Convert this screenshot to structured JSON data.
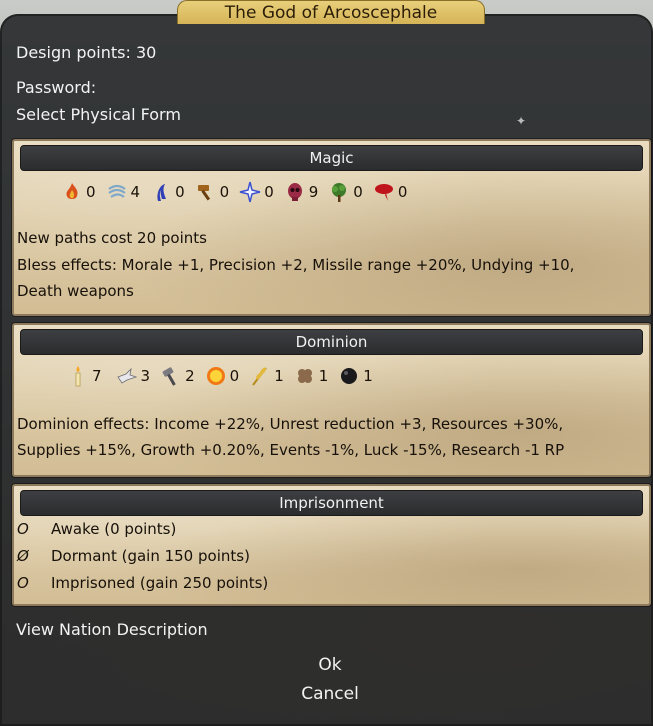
{
  "window": {
    "title": "The God of Arcoscephale"
  },
  "header": {
    "design_points": "Design points: 30",
    "password_label": "Password:",
    "physical_form_link": "Select Physical Form"
  },
  "magic": {
    "title": "Magic",
    "paths": [
      {
        "icon": "fire-icon",
        "value": "0"
      },
      {
        "icon": "air-icon",
        "value": "4"
      },
      {
        "icon": "water-icon",
        "value": "0"
      },
      {
        "icon": "earth-icon",
        "value": "0"
      },
      {
        "icon": "astral-icon",
        "value": "0"
      },
      {
        "icon": "death-icon",
        "value": "9"
      },
      {
        "icon": "nature-icon",
        "value": "0"
      },
      {
        "icon": "blood-icon",
        "value": "0"
      }
    ],
    "cost_text": "New paths cost 20 points",
    "bless_line1": "Bless effects: Morale +1, Precision +2, Missile range +20%, Undying +10,",
    "bless_line2": "Death weapons"
  },
  "dominion": {
    "title": "Dominion",
    "scales": [
      {
        "icon": "candle-icon",
        "value": "7"
      },
      {
        "icon": "dove-icon",
        "value": "3"
      },
      {
        "icon": "hammer-icon",
        "value": "2"
      },
      {
        "icon": "sun-icon",
        "value": "0"
      },
      {
        "icon": "wheat-icon",
        "value": "1"
      },
      {
        "icon": "clover-icon",
        "value": "1"
      },
      {
        "icon": "orb-icon",
        "value": "1"
      }
    ],
    "effects_line1": "Dominion effects: Income +22%, Unrest reduction +3, Resources +30%,",
    "effects_line2": "Supplies +15%, Growth +0.20%, Events -1%, Luck -15%, Research -1 RP"
  },
  "imprisonment": {
    "title": "Imprisonment",
    "options": [
      {
        "mark": "O",
        "label": "Awake (0 points)",
        "selected": false
      },
      {
        "mark": "Ø",
        "label": "Dormant (gain 150 points)",
        "selected": true
      },
      {
        "mark": "O",
        "label": "Imprisoned (gain 250 points)",
        "selected": false
      }
    ]
  },
  "footer": {
    "view_nation": "View Nation Description",
    "ok": "Ok",
    "cancel": "Cancel"
  },
  "colors": {
    "title_tab": "#d6b458",
    "panel": "#2a2c2e",
    "parchment": "#dccaa5"
  }
}
